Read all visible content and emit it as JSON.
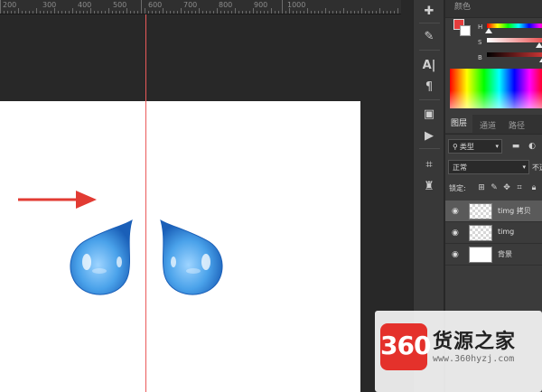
{
  "ruler": {
    "labels": [
      "200",
      "300",
      "400",
      "500",
      "600",
      "700",
      "800",
      "900",
      "1000"
    ]
  },
  "panels": {
    "color_tab": "颜色",
    "channels": {
      "h": "H",
      "s": "S",
      "b": "B"
    },
    "layer_tabs": [
      "图层",
      "通道",
      "路径"
    ],
    "filter_kind": "类型",
    "blend_mode": "正常",
    "opacity_label": "不透",
    "lock_label": "锁定:",
    "layers": [
      {
        "name": "timg 拷贝",
        "selected": true
      },
      {
        "name": "timg",
        "selected": false
      },
      {
        "name": "背景",
        "selected": false
      }
    ]
  },
  "watermark": {
    "number": "360",
    "title": "货源之家",
    "url": "www.360hyzj.com"
  },
  "colors": {
    "foreground": "#e53c3c",
    "background": "#ffffff",
    "guide": "#ea5a5a",
    "arrow": "#e23b33",
    "drop": "#3b8fe0"
  },
  "icons": [
    "puzzle-icon",
    "brush-icon",
    "text-icon",
    "paragraph-icon",
    "layers-comp-icon",
    "play-icon",
    "crop-icon",
    "stamp-icon",
    "search-icon",
    "image-filter-icon",
    "lock-pixels-icon",
    "brush-lock-icon",
    "move-lock-icon",
    "artboard-lock-icon",
    "lock-all-icon",
    "eye-icon"
  ]
}
